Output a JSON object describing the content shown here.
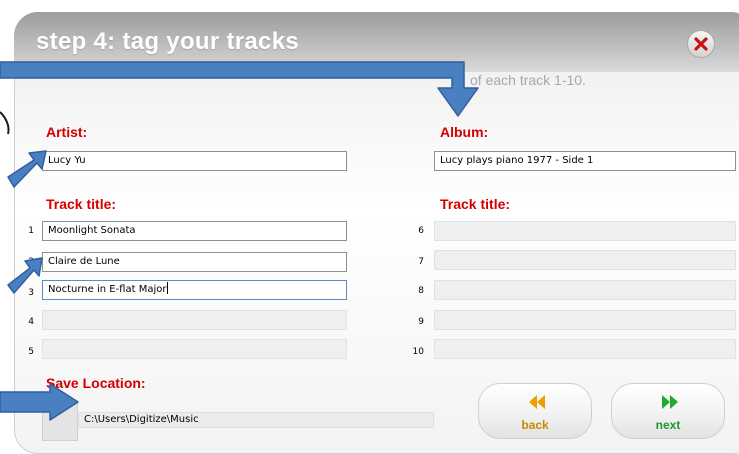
{
  "header": {
    "title": "step 4: tag your tracks",
    "instruction": "of each track 1-10."
  },
  "artist": {
    "label": "Artist:",
    "value": "Lucy Yu"
  },
  "album": {
    "label": "Album:",
    "value": "Lucy plays piano 1977 - Side 1"
  },
  "tracks_left": {
    "label": "Track title:",
    "rows": [
      {
        "num": "1",
        "value": "Moonlight Sonata"
      },
      {
        "num": "2",
        "value": "Claire de Lune"
      },
      {
        "num": "3",
        "value": "Nocturne in E-flat Major"
      },
      {
        "num": "4",
        "value": ""
      },
      {
        "num": "5",
        "value": ""
      }
    ]
  },
  "tracks_right": {
    "label": "Track title:",
    "rows": [
      {
        "num": "6",
        "value": ""
      },
      {
        "num": "7",
        "value": ""
      },
      {
        "num": "8",
        "value": ""
      },
      {
        "num": "9",
        "value": ""
      },
      {
        "num": "10",
        "value": ""
      }
    ]
  },
  "save": {
    "label": "Save Location:",
    "path": "C:\\Users\\Digitize\\Music"
  },
  "buttons": {
    "back": "back",
    "next": "next"
  },
  "icons": {
    "close": "close-icon",
    "back": "rewind-icon",
    "next": "fast-forward-icon",
    "pointer": "arrow-icon"
  },
  "colors": {
    "label_red": "#d40000",
    "arrow_blue": "#4a7fc1",
    "back_gold": "#c88a00",
    "next_green": "#1d9a2a"
  }
}
